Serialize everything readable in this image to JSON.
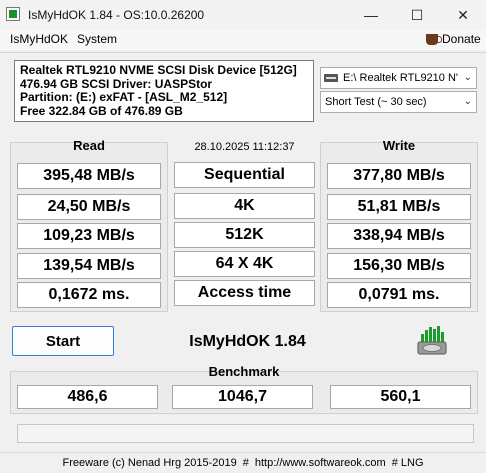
{
  "window": {
    "title": "IsMyHdOK 1.84 - OS:10.0.26200",
    "minimize_glyph": "—",
    "maximize_glyph": "☐",
    "close_glyph": "✕"
  },
  "menu": {
    "items": [
      "IsMyHdOK",
      "System"
    ],
    "donate_label": "Donate",
    "donate_icon": "coffee-cup-icon"
  },
  "disk_info": {
    "line1": "Realtek RTL9210 NVME SCSI Disk Device [512G]",
    "line2": "476.94 GB  SCSI Driver: UASPStor",
    "line3": "Partition: (E:) exFAT - [ASL_M2_512]",
    "line4": "Free 322.84 GB of 476.89 GB"
  },
  "drive_select": {
    "value": "E:\\ Realtek RTL9210 N'"
  },
  "test_select": {
    "value": "Short Test (~ 30 sec)"
  },
  "datetime": "28.10.2025 11:12:37",
  "read": {
    "title": "Read",
    "values": [
      "395,48 MB/s",
      "24,50 MB/s",
      "109,23 MB/s",
      "139,54 MB/s",
      "0,1672 ms."
    ]
  },
  "write": {
    "title": "Write",
    "values": [
      "377,80 MB/s",
      "51,81 MB/s",
      "338,94 MB/s",
      "156,30 MB/s",
      "0,0791 ms."
    ]
  },
  "tests": [
    "Sequential",
    "4K",
    "512K",
    "64 X 4K",
    "Access time"
  ],
  "start_label": "Start",
  "app_label": "IsMyHdOK 1.84",
  "benchmark": {
    "title": "Benchmark",
    "values": [
      "486,6",
      "1046,7",
      "560,1"
    ]
  },
  "status_bar": {
    "copyright": "Freeware (c) Nenad Hrg 2015-2019",
    "separator": "#",
    "url": "http://www.softwareok.com",
    "lng": "# LNG"
  }
}
